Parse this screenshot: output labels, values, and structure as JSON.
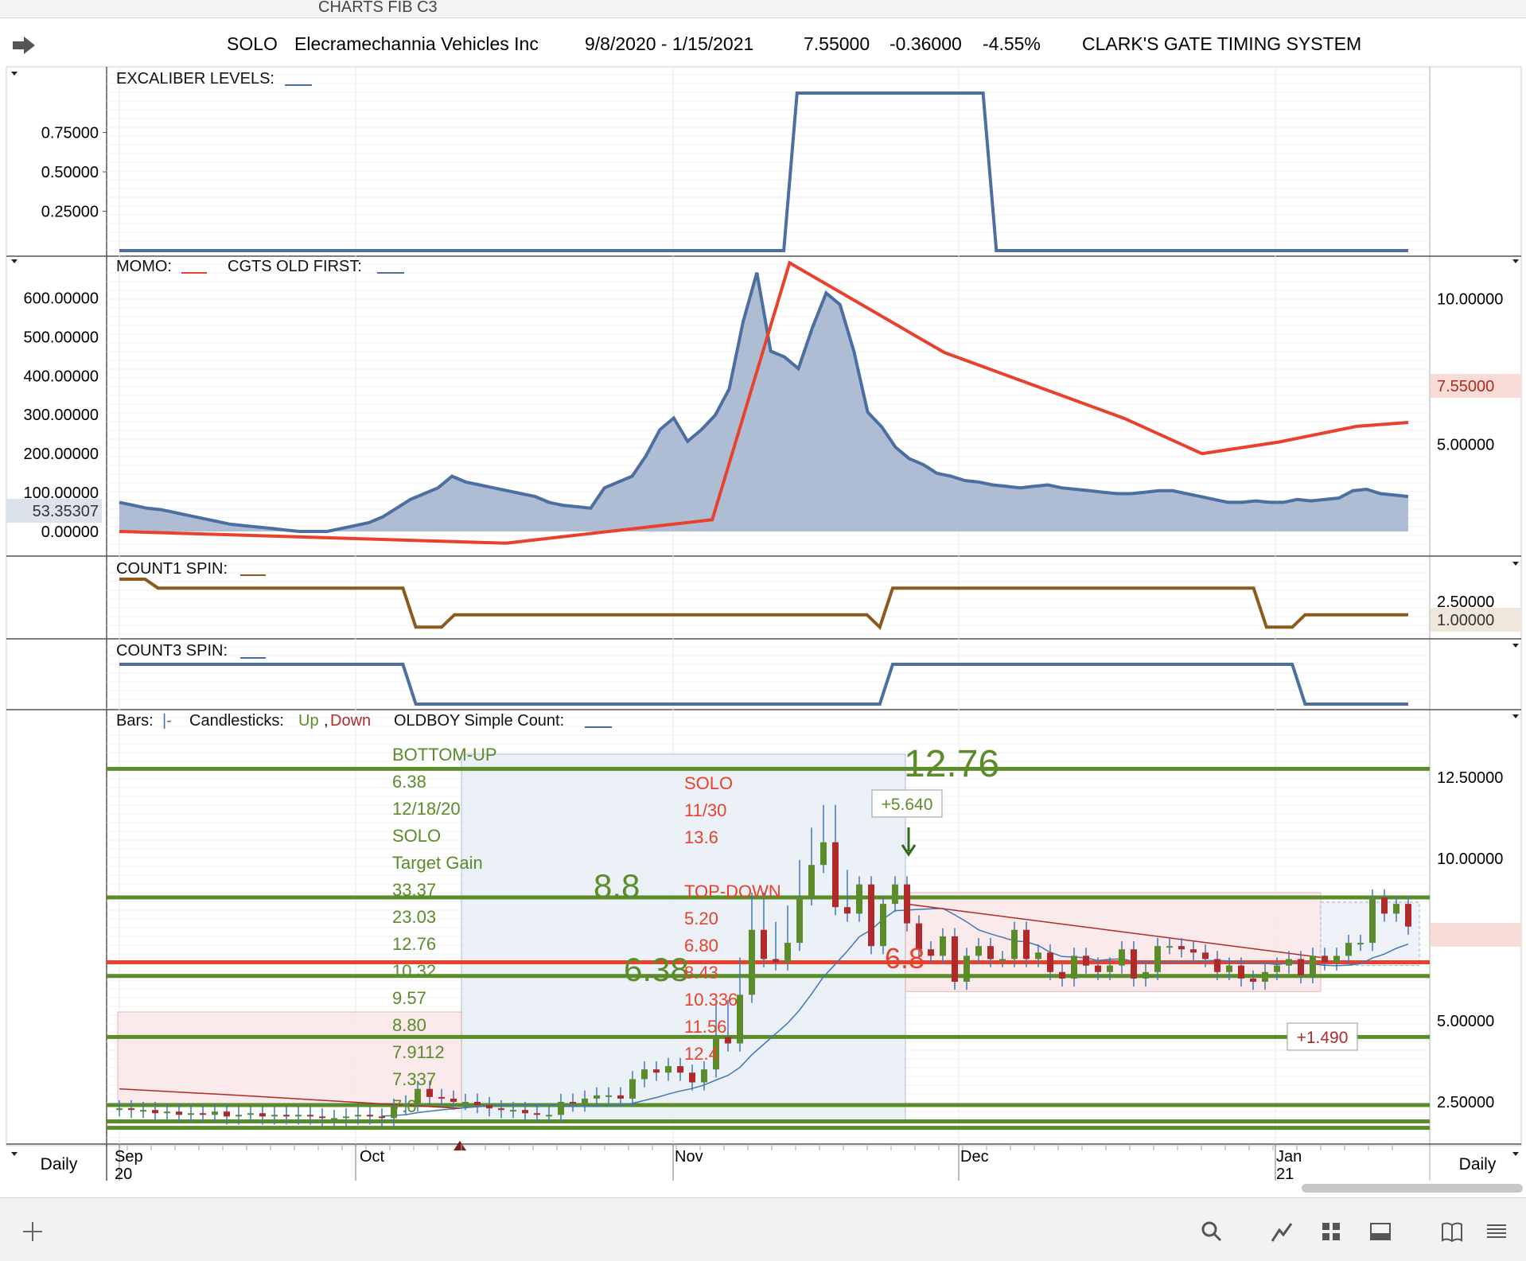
{
  "window": {
    "title": "CHARTS FIB C3"
  },
  "header": {
    "symbol": "SOLO",
    "company": "Elecramechannia Vehicles Inc",
    "date_range": "9/8/2020 - 1/15/2021",
    "last": "7.55000",
    "change": "-0.36000",
    "change_pct": "-4.55%",
    "system": "CLARK'S GATE TIMING SYSTEM",
    "arrow_icon": "forward-arrow-icon"
  },
  "colors": {
    "red": "#e8412c",
    "blue": "#4b6fa0",
    "brown": "#8c5a1c",
    "green": "#5b8c2a",
    "downcandle": "#b02a2a",
    "fill": "#a5b6cf"
  },
  "timeframe": {
    "left": "Daily",
    "right": "Daily"
  },
  "x_axis": {
    "ticks": [
      {
        "month": "Sep",
        "sub": "20"
      },
      {
        "month": "Oct",
        "sub": ""
      },
      {
        "month": "Nov",
        "sub": ""
      },
      {
        "month": "Dec",
        "sub": ""
      },
      {
        "month": "Jan",
        "sub": "21"
      }
    ]
  },
  "chart_data": [
    {
      "panel": "excaliber",
      "type": "line",
      "legend": "EXCALIBER LEVELS:",
      "yticks": [
        "0.75000",
        "0.50000",
        "0.25000"
      ],
      "ylim": [
        0,
        1
      ],
      "series": [
        {
          "color": "#4b6fa0",
          "values": [
            0,
            0,
            0,
            0,
            0,
            0,
            0,
            0,
            0,
            0,
            0,
            0,
            0,
            0,
            0,
            0,
            0,
            0,
            0,
            0,
            0,
            0,
            0,
            0,
            0,
            0,
            0,
            0,
            0,
            0,
            0,
            0,
            0,
            0,
            0,
            0,
            0,
            0,
            0,
            0,
            0,
            0,
            0,
            0,
            0,
            0,
            0,
            0,
            0,
            0,
            0,
            1,
            1,
            1,
            1,
            1,
            1,
            1,
            1,
            1,
            1,
            1,
            1,
            1,
            1,
            1,
            0,
            0,
            0,
            0,
            0,
            0,
            0,
            0,
            0,
            0,
            0,
            0,
            0,
            0,
            0,
            0,
            0,
            0,
            0,
            0,
            0,
            0,
            0,
            0,
            0,
            0,
            0,
            0,
            0,
            0,
            0,
            0
          ]
        }
      ]
    },
    {
      "panel": "momo",
      "type": "line",
      "legend_momo": "MOMO:",
      "legend_cgts": "CGTS OLD FIRST:",
      "left_yticks": [
        "600.00000",
        "500.00000",
        "400.00000",
        "300.00000",
        "200.00000",
        "100.00000",
        "0.00000"
      ],
      "right_yticks": [
        "10.00000",
        "5.00000"
      ],
      "left_ylim": [
        0,
        650
      ],
      "right_ylim": [
        2,
        10.7
      ],
      "left_readout": "53.35307",
      "right_readout": "7.55000",
      "cgts": [
        3.0,
        2.9,
        2.8,
        2.75,
        2.65,
        2.55,
        2.45,
        2.35,
        2.25,
        2.2,
        2.15,
        2.1,
        2.05,
        2.0,
        2.0,
        2.0,
        2.1,
        2.2,
        2.3,
        2.5,
        2.8,
        3.1,
        3.3,
        3.5,
        3.9,
        3.7,
        3.6,
        3.5,
        3.4,
        3.3,
        3.2,
        3.0,
        2.9,
        2.85,
        2.8,
        3.5,
        3.7,
        3.9,
        4.6,
        5.5,
        5.9,
        5.1,
        5.5,
        6.0,
        6.9,
        9.2,
        10.9,
        8.2,
        8.0,
        7.6,
        9.0,
        10.2,
        9.8,
        8.2,
        6.1,
        5.6,
        4.9,
        4.5,
        4.3,
        4.0,
        3.9,
        3.75,
        3.7,
        3.6,
        3.55,
        3.5,
        3.55,
        3.6,
        3.5,
        3.45,
        3.4,
        3.35,
        3.3,
        3.3,
        3.35,
        3.4,
        3.4,
        3.3,
        3.2,
        3.1,
        3.0,
        3.0,
        3.05,
        3.0,
        3.0,
        3.1,
        3.05,
        3.1,
        3.15,
        3.4,
        3.45,
        3.3,
        3.25,
        3.2
      ],
      "momo_points": [
        [
          0,
          0
        ],
        [
          30,
          -30
        ],
        [
          46,
          30
        ],
        [
          52,
          690
        ],
        [
          64,
          460
        ],
        [
          78,
          290
        ],
        [
          84,
          200
        ],
        [
          90,
          230
        ],
        [
          96,
          270
        ],
        [
          100,
          280
        ]
      ]
    },
    {
      "panel": "count1",
      "type": "line",
      "legend": "COUNT1 SPIN:",
      "right_ytick": "2.50000",
      "right_readout": "1.00000",
      "ylim": [
        0,
        3
      ],
      "series": [
        {
          "color": "#8c5a1c",
          "points": [
            [
              0,
              3.0
            ],
            [
              2,
              3.0
            ],
            [
              3,
              2.5
            ],
            [
              22,
              2.5
            ],
            [
              23,
              0.3
            ],
            [
              25,
              0.3
            ],
            [
              26,
              1.0
            ],
            [
              58,
              1.0
            ],
            [
              59,
              0.3
            ],
            [
              60,
              2.5
            ],
            [
              88,
              2.5
            ],
            [
              89,
              0.3
            ],
            [
              91,
              0.3
            ],
            [
              92,
              1.0
            ],
            [
              100,
              1.0
            ]
          ]
        }
      ]
    },
    {
      "panel": "count3",
      "type": "line",
      "legend": "COUNT3 SPIN:",
      "ylim": [
        0,
        1
      ],
      "series": [
        {
          "color": "#4b6fa0",
          "points": [
            [
              0,
              1
            ],
            [
              22,
              1
            ],
            [
              23,
              0
            ],
            [
              59,
              0
            ],
            [
              60,
              1
            ],
            [
              91,
              1
            ],
            [
              92,
              0
            ],
            [
              100,
              0
            ]
          ]
        }
      ]
    },
    {
      "panel": "price",
      "type": "candlestick",
      "legend_bars": "Bars:",
      "legend_bars_glyph": "|-",
      "legend_candles": "Candlesticks:",
      "legend_up": "Up",
      "legend_sep": ",",
      "legend_down": "Down",
      "legend_oldboy": "OLDBOY Simple Count:",
      "right_yticks": [
        "12.50000",
        "10.00000",
        "7.55000",
        "5.00000",
        "2.50000"
      ],
      "ylim": [
        1.2,
        13.8
      ],
      "close": [
        2.3,
        2.25,
        2.25,
        2.15,
        2.2,
        2.1,
        2.15,
        2.1,
        2.2,
        2.05,
        2.1,
        2.15,
        2.05,
        2.1,
        2.05,
        2.1,
        2.05,
        2.0,
        2.0,
        2.05,
        2.1,
        2.05,
        2.0,
        2.35,
        2.45,
        2.9,
        2.65,
        2.6,
        2.5,
        2.5,
        2.4,
        2.3,
        2.25,
        2.25,
        2.15,
        2.1,
        2.1,
        2.5,
        2.45,
        2.6,
        2.7,
        2.7,
        2.6,
        3.2,
        3.5,
        3.4,
        3.6,
        3.4,
        3.1,
        3.5,
        4.5,
        4.3,
        5.8,
        7.8,
        6.9,
        6.8,
        7.4,
        8.8,
        9.8,
        10.5,
        8.5,
        8.3,
        9.2,
        7.3,
        8.6,
        9.2,
        8.0,
        7.2,
        7.0,
        7.6,
        6.2,
        7.0,
        7.3,
        6.9,
        6.9,
        7.8,
        6.9,
        7.1,
        6.5,
        6.3,
        7.0,
        6.7,
        6.5,
        6.7,
        7.2,
        6.3,
        6.5,
        7.3,
        7.3,
        7.2,
        7.1,
        6.9,
        6.5,
        6.7,
        6.3,
        6.2,
        6.5,
        6.7,
        6.9,
        6.4,
        7.0,
        6.8,
        7.0,
        7.4,
        7.4,
        8.8,
        8.3,
        8.6,
        7.9
      ],
      "levels": {
        "green": [
          12.76,
          8.8,
          6.38,
          4.5,
          2.4,
          1.9,
          1.7
        ],
        "red": [
          6.8
        ]
      },
      "labels": {
        "big_1276": "12.76",
        "big_88": "8.8",
        "big_638": "6.38",
        "big_68": "6.8",
        "gain_top": "+5.640",
        "gain_bottom": "+1.490"
      },
      "bottom_up_list": [
        "BOTTOM-UP",
        "6.38",
        "12/18/20",
        "SOLO",
        "Target Gain",
        "33.37",
        "23.03",
        "12.76",
        "10.32",
        "9.57",
        "8.80",
        "7.9112",
        "7.337",
        "7.0"
      ],
      "top_down_list": [
        "SOLO",
        "11/30",
        "13.6",
        "",
        "TOP-DOWN",
        "5.20",
        "6.80",
        "8.43",
        "10.336",
        "11.56",
        "12.4"
      ]
    }
  ],
  "toolbar": {
    "add_icon": "plus-icon",
    "search_icon": "search-icon",
    "draw_icon": "line-draw-icon",
    "grid_icon": "grid-icon",
    "panel_icon": "panel-icon",
    "book_icon": "book-icon",
    "menu_icon": "menu-icon"
  }
}
